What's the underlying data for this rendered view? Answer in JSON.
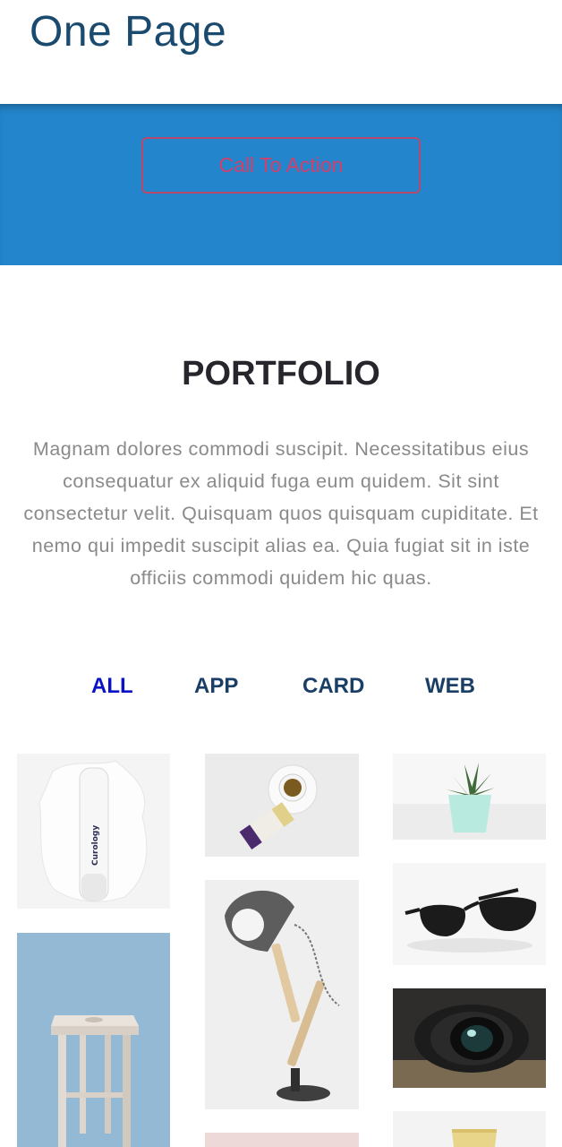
{
  "header": {
    "brand": "One Page"
  },
  "hero": {
    "cta_label": "Call To Action"
  },
  "portfolio": {
    "title": "PORTFOLIO",
    "description": "Magnam dolores commodi suscipit. Necessitatibus eius consequatur ex aliquid fuga eum quidem. Sit sint consectetur velit. Quisquam quos quisquam cupiditate. Et nemo qui impedit suscipit alias ea. Quia fugiat sit in iste officiis commodi quidem hic quas.",
    "filters": [
      "ALL",
      "APP",
      "CARD",
      "WEB"
    ],
    "active_filter": "ALL",
    "items": [
      {
        "subject": "lotion bottle",
        "label": "Curology"
      },
      {
        "subject": "coffee cup and snack pack"
      },
      {
        "subject": "succulent plant pot"
      },
      {
        "subject": "wooden stool"
      },
      {
        "subject": "desk lamp"
      },
      {
        "subject": "sunglasses"
      },
      {
        "subject": "camera lens"
      },
      {
        "subject": "pink item"
      },
      {
        "subject": "glass of drink"
      }
    ]
  },
  "colors": {
    "brand": "#1a4a6e",
    "hero": "#2385cb",
    "cta": "#d2406c",
    "active_filter": "#0a12c8"
  }
}
